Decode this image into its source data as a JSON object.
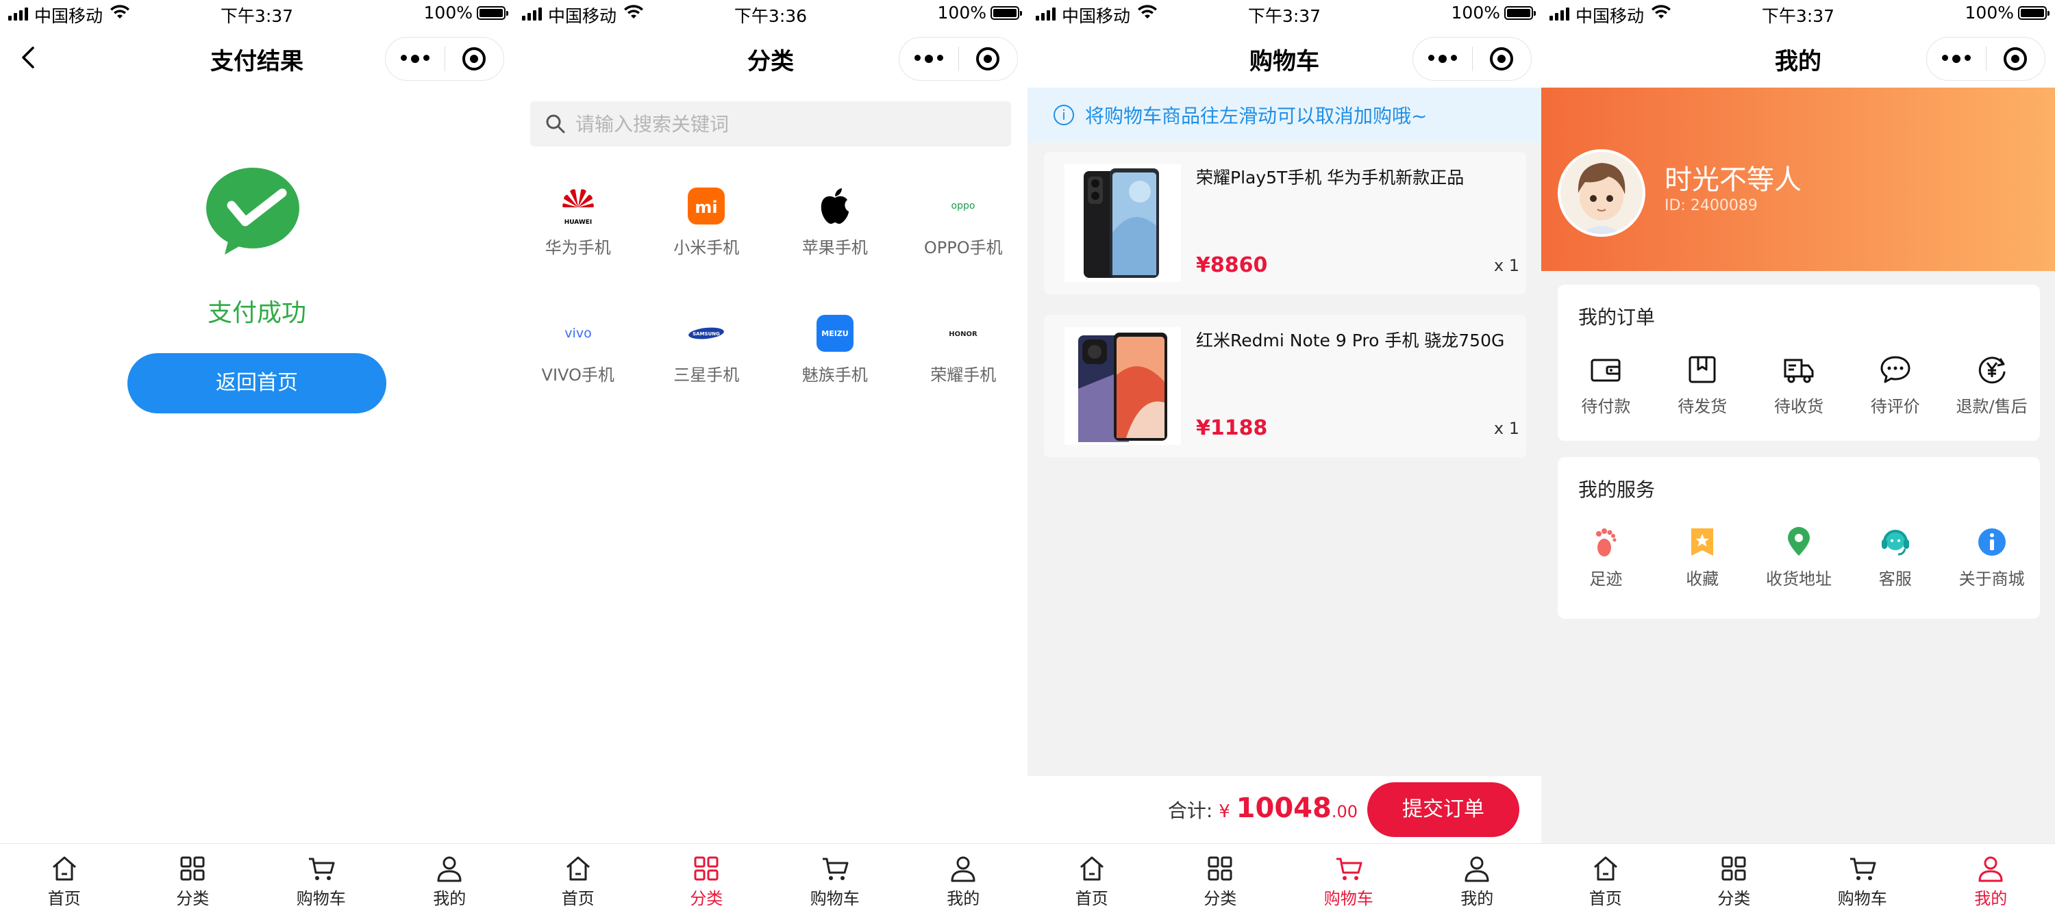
{
  "status_bar": {
    "carrier": "中国移动",
    "battery": "100%",
    "times": [
      "下午3:37",
      "下午3:36",
      "下午3:37",
      "下午3:37"
    ]
  },
  "tabbar": {
    "items": [
      {
        "label": "首页",
        "icon": "home-icon"
      },
      {
        "label": "分类",
        "icon": "category-grid-icon"
      },
      {
        "label": "购物车",
        "icon": "cart-icon"
      },
      {
        "label": "我的",
        "icon": "user-icon"
      }
    ],
    "active_color": "#e8173b"
  },
  "payment_result": {
    "title": "支付结果",
    "status_text": "支付成功",
    "return_button": "返回首页",
    "success_color": "#2fab45"
  },
  "category": {
    "title": "分类",
    "search_placeholder": "请输入搜索关键词",
    "brands": [
      {
        "logo_text": "HUAWEI",
        "name": "华为手机"
      },
      {
        "logo_text": "mi",
        "name": "小米手机"
      },
      {
        "logo_text": "",
        "name": "苹果手机"
      },
      {
        "logo_text": "oppo",
        "name": "OPPO手机"
      },
      {
        "logo_text": "vivo",
        "name": "VIVO手机"
      },
      {
        "logo_text": "SAMSUNG",
        "name": "三星手机"
      },
      {
        "logo_text": "MEIZU",
        "name": "魅族手机"
      },
      {
        "logo_text": "HONOR",
        "name": "荣耀手机"
      }
    ]
  },
  "cart": {
    "title": "购物车",
    "notice": "将购物车商品往左滑动可以取消加购哦~",
    "items": [
      {
        "name": "荣耀Play5T手机 华为手机新款正品",
        "price": "¥8860",
        "qty": "x 1"
      },
      {
        "name": "红米Redmi Note 9 Pro 手机 骁龙750G",
        "price": "¥1188",
        "qty": "x 1"
      }
    ],
    "total_label": "合计:",
    "currency": "¥",
    "total_int": "10048",
    "total_dec": ".00",
    "submit": "提交订单"
  },
  "mine": {
    "title": "我的",
    "username": "时光不等人",
    "user_id": "ID: 2400089",
    "orders": {
      "title": "我的订单",
      "items": [
        "待付款",
        "待发货",
        "待收货",
        "待评价",
        "退款/售后"
      ]
    },
    "services": {
      "title": "我的服务",
      "items": [
        "足迹",
        "收藏",
        "收货地址",
        "客服",
        "关于商城"
      ]
    }
  }
}
